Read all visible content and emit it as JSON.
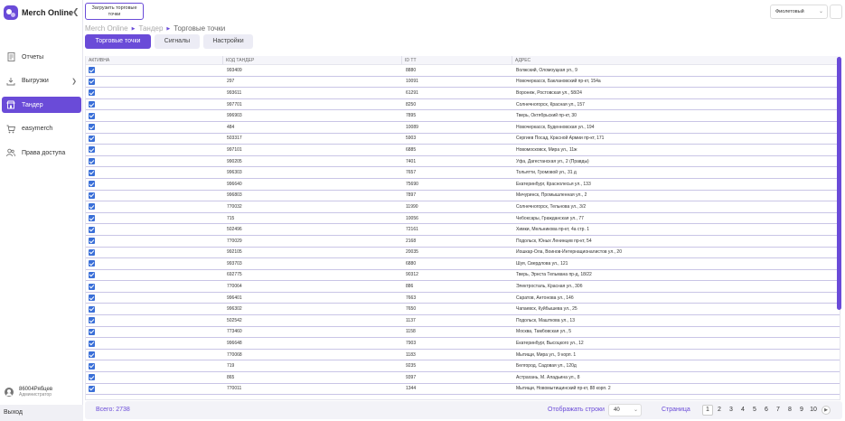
{
  "app": {
    "name": "Merch Online",
    "upload_button": "Загрузить торговые точки",
    "theme_value": "Фиолетовый"
  },
  "sidebar": {
    "items": [
      {
        "label": "Отчеты",
        "icon": "document-icon",
        "active": false
      },
      {
        "label": "Выгрузки",
        "icon": "download-icon",
        "active": false,
        "has_submenu": true
      },
      {
        "label": "Тандер",
        "icon": "store-icon",
        "active": true
      },
      {
        "label": "easymerch",
        "icon": "cart-icon",
        "active": false
      },
      {
        "label": "Права доступа",
        "icon": "users-icon",
        "active": false
      }
    ],
    "user_name": "86004Рябцев",
    "user_role": "Администратор",
    "logout": "Выход"
  },
  "breadcrumb": {
    "items": [
      "Merch Online",
      "Тандер",
      "Торговые точки"
    ]
  },
  "tabs": [
    {
      "label": "Торговые точки",
      "active": true
    },
    {
      "label": "Сигналы",
      "active": false
    },
    {
      "label": "Настройки",
      "active": false
    }
  ],
  "table": {
    "columns": [
      "АКТИВНА",
      "КОД ТАНДЕР",
      "ID ТТ",
      "АДРЕС"
    ],
    "rows": [
      {
        "code": "993409",
        "id": "8880",
        "address": "Волжский, Оломоуцкая ул., 9"
      },
      {
        "code": "297",
        "id": "10091",
        "address": "Новочеркасск, Баклановский пр-кт, 154а"
      },
      {
        "code": "993611",
        "id": "61291",
        "address": "Воронеж, Ростовская ул., 58/24"
      },
      {
        "code": "997701",
        "id": "8250",
        "address": "Солнечногорск, Красная ул., 157"
      },
      {
        "code": "996903",
        "id": "7895",
        "address": "Тверь, Октябрьский пр-кт, 30"
      },
      {
        "code": "484",
        "id": "10089",
        "address": "Новочеркасск, Буденновская ул., 194"
      },
      {
        "code": "503317",
        "id": "5903",
        "address": "Сергиев Посад, Красной Армии пр-кт, 171"
      },
      {
        "code": "997101",
        "id": "6885",
        "address": "Новомосковск, Мира ул., 11ж"
      },
      {
        "code": "990205",
        "id": "7401",
        "address": "Уфа, Дагестанская ул., 2 (Правды)"
      },
      {
        "code": "996303",
        "id": "7657",
        "address": "Тольятти, Громовой ул., 31 д"
      },
      {
        "code": "996640",
        "id": "75690",
        "address": "Екатеринбург, Краснолесья ул., 133"
      },
      {
        "code": "996803",
        "id": "7897",
        "address": "Мичуринск, Промышленная ул., 2"
      },
      {
        "code": "770032",
        "id": "11990",
        "address": "Солнечногорск, Тельнова ул., 3/2"
      },
      {
        "code": "715",
        "id": "10056",
        "address": "Чебоксары, Гражданская ул., 77"
      },
      {
        "code": "502496",
        "id": "72161",
        "address": "Химки, Мельникова пр-кт, 4а стр. 1"
      },
      {
        "code": "770029",
        "id": "2168",
        "address": "Подольск, Юных Ленинцев пр-кт, 54"
      },
      {
        "code": "992105",
        "id": "20035",
        "address": "Йошкар-Ола, Воинов-Интернационалистов ул., 20"
      },
      {
        "code": "993703",
        "id": "6880",
        "address": "Шуя, Свердлова ул., 121"
      },
      {
        "code": "692775",
        "id": "90312",
        "address": "Тверь, Эрнста Тельмана пр-д, 18/22"
      },
      {
        "code": "770064",
        "id": "886",
        "address": "Электросталь, Красная ул., 30б"
      },
      {
        "code": "996401",
        "id": "7663",
        "address": "Саратов, Антонова ул., 14б"
      },
      {
        "code": "996302",
        "id": "7650",
        "address": "Чапаевск, Куйбышева ул., 25"
      },
      {
        "code": "502542",
        "id": "1137",
        "address": "Подольск, Машткова ул., 13"
      },
      {
        "code": "773460",
        "id": "1158",
        "address": "Москва, Тамбовская ул., 5"
      },
      {
        "code": "996648",
        "id": "7903",
        "address": "Екатеринбург, Высоцкого ул., 12"
      },
      {
        "code": "770068",
        "id": "1183",
        "address": "Мытищи, Мира ул., 9 корп. 1"
      },
      {
        "code": "719",
        "id": "9235",
        "address": "Белгород, Садовая ул., 120д"
      },
      {
        "code": "865",
        "id": "9397",
        "address": "Астрахань, М. Аладьина ул., 8"
      },
      {
        "code": "770011",
        "id": "1344",
        "address": "Мытищи, Новомытищинский пр-кт, 88 корп. 2"
      }
    ]
  },
  "footer": {
    "total": "Всего: 2738",
    "rows_label": "Отображать строки",
    "rows_value": "40",
    "page_label": "Страница",
    "pages": [
      "1",
      "2",
      "3",
      "4",
      "5",
      "6",
      "7",
      "8",
      "9",
      "10"
    ],
    "current_page": "1"
  }
}
